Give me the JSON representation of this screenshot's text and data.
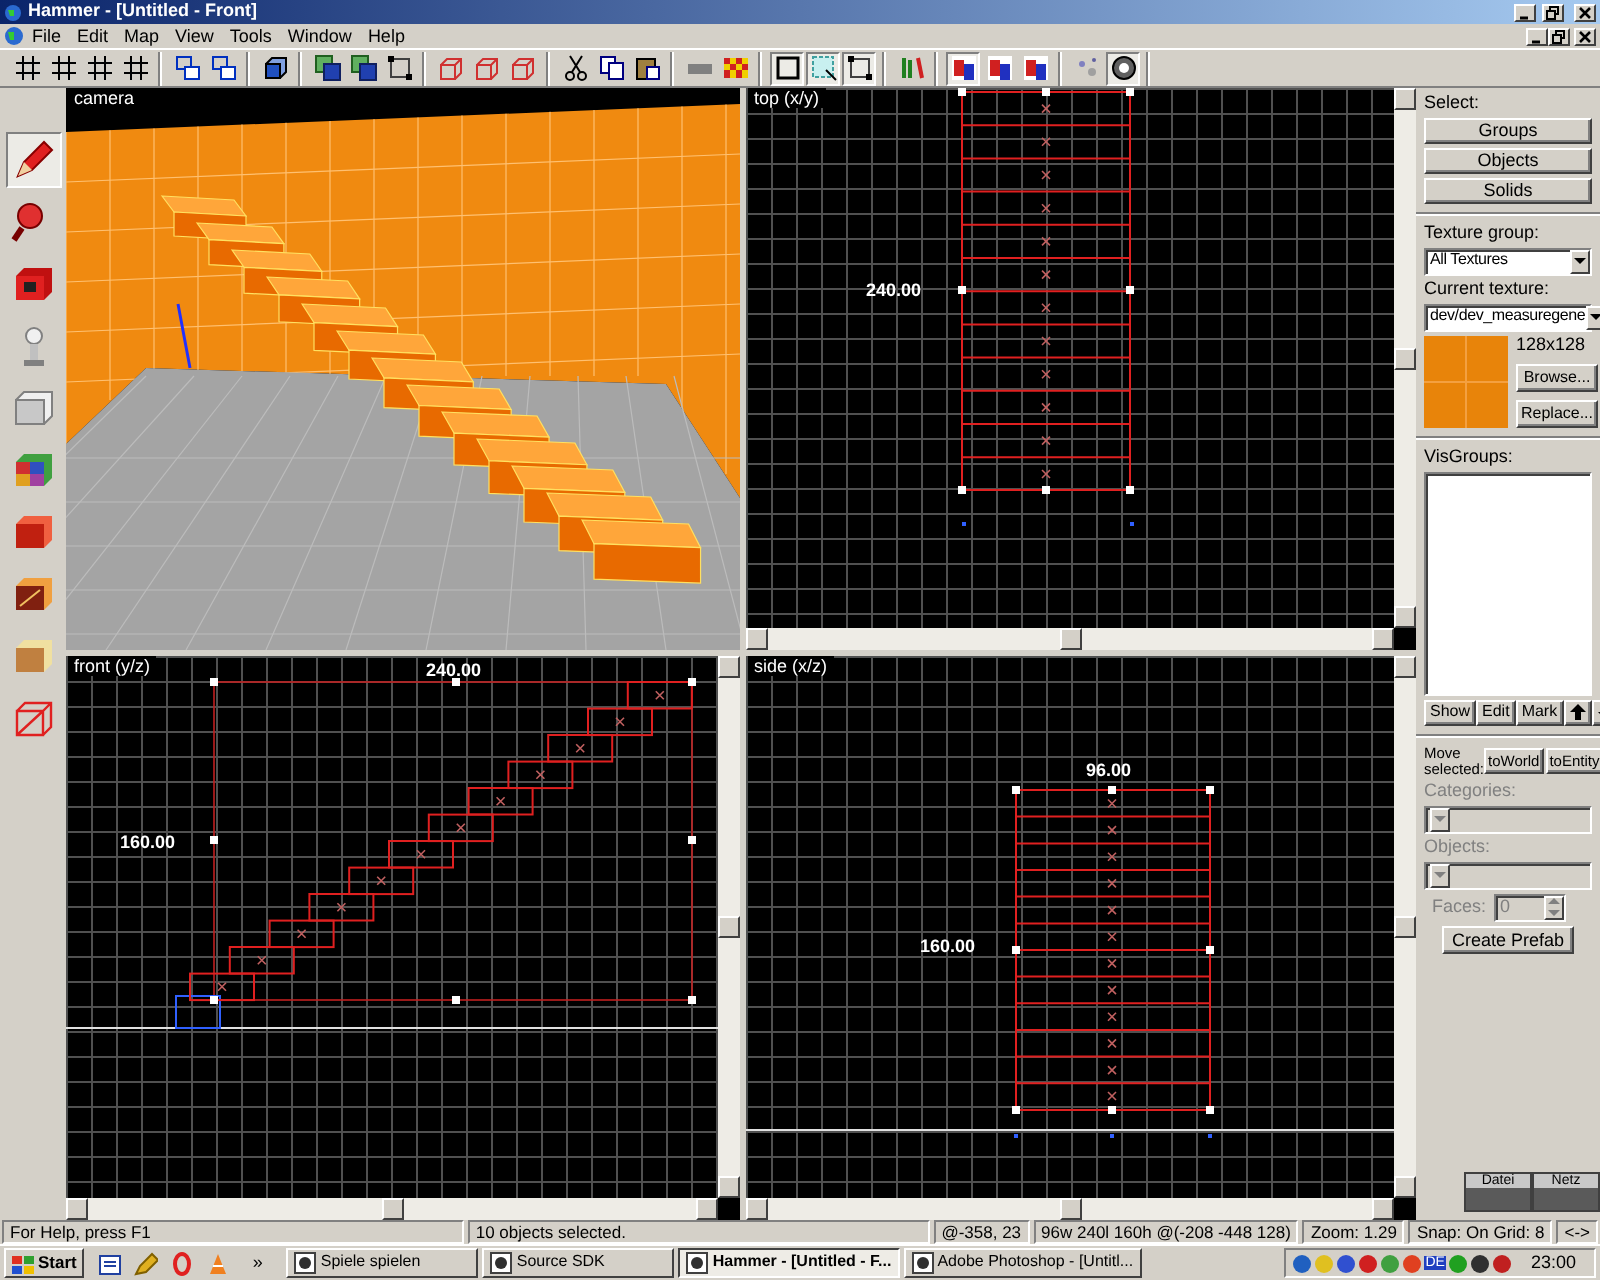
{
  "window": {
    "title": "Hammer - [Untitled - Front]"
  },
  "menu": [
    "File",
    "Edit",
    "Map",
    "View",
    "Tools",
    "Window",
    "Help"
  ],
  "toolbar": [
    [
      {
        "kind": "grid",
        "pressed": false
      },
      {
        "kind": "grid",
        "pressed": false
      },
      {
        "kind": "grid",
        "pressed": false
      },
      {
        "kind": "grid",
        "pressed": false
      }
    ],
    [
      {
        "kind": "layers",
        "pressed": false
      },
      {
        "kind": "layers",
        "pressed": false
      }
    ],
    [
      {
        "kind": "cube",
        "pressed": false
      }
    ],
    [
      {
        "kind": "group",
        "pressed": false
      },
      {
        "kind": "group",
        "pressed": false
      },
      {
        "kind": "handles",
        "pressed": false
      }
    ],
    [
      {
        "kind": "wirecube",
        "pressed": false
      },
      {
        "kind": "wirecube",
        "pressed": false
      },
      {
        "kind": "wirecube",
        "pressed": false
      }
    ],
    [
      {
        "kind": "scissors",
        "pressed": false
      },
      {
        "kind": "copy",
        "pressed": false
      },
      {
        "kind": "paste",
        "pressed": false
      }
    ],
    [
      {
        "kind": "bar",
        "pressed": false
      },
      {
        "kind": "checker",
        "pressed": false
      }
    ],
    [
      {
        "kind": "square",
        "pressed": true
      },
      {
        "kind": "dashed",
        "pressed": true
      },
      {
        "kind": "handles",
        "pressed": true
      }
    ],
    [
      {
        "kind": "sticks",
        "pressed": false
      }
    ],
    [
      {
        "kind": "tile",
        "pressed": true
      },
      {
        "kind": "tile",
        "pressed": false
      },
      {
        "kind": "tile",
        "pressed": false
      }
    ],
    [
      {
        "kind": "sparkle",
        "pressed": false
      },
      {
        "kind": "sphere",
        "pressed": true
      }
    ]
  ],
  "tools": [
    {
      "kind": "pencil",
      "selected": true
    },
    {
      "kind": "magnifier",
      "selected": false
    },
    {
      "kind": "camera",
      "selected": false
    },
    {
      "kind": "lamp",
      "selected": false
    },
    {
      "kind": "block",
      "selected": false
    },
    {
      "kind": "texture",
      "selected": false
    },
    {
      "kind": "redcube",
      "selected": false
    },
    {
      "kind": "darkcube",
      "selected": false
    },
    {
      "kind": "browncube",
      "selected": false
    },
    {
      "kind": "wire",
      "selected": false
    }
  ],
  "viewports": [
    {
      "kind": "camera",
      "label": "camera"
    },
    {
      "kind": "top",
      "label": "top (x/y)",
      "height_label": "240.00"
    },
    {
      "kind": "front",
      "label": "front (y/z)",
      "width_label": "240.00",
      "height_label": "160.00"
    },
    {
      "kind": "side",
      "label": "side (x/z)",
      "width_label": "96.00",
      "height_label": "160.00"
    }
  ],
  "side_panel": {
    "select_label": "Select:",
    "select_buttons": [
      "Groups",
      "Objects",
      "Solids"
    ],
    "texture_group": {
      "label": "Texture group:",
      "value": "All Textures"
    },
    "current_texture": {
      "label": "Current texture:",
      "value": "dev/dev_measuregene",
      "size": "128x128"
    },
    "texture_buttons": [
      "Browse...",
      "Replace..."
    ],
    "visgroups": {
      "label": "VisGroups:",
      "buttons": [
        "Show",
        "Edit",
        "Mark"
      ]
    },
    "move": {
      "label": "Move selected:",
      "buttons": [
        "toWorld",
        "toEntity"
      ]
    },
    "categories": {
      "label": "Categories:",
      "disabled": true
    },
    "objects": {
      "label": "Objects:",
      "disabled": true
    },
    "faces": {
      "label": "Faces:",
      "value": "0",
      "disabled": true
    },
    "create_prefab": "Create Prefab"
  },
  "corner_widget": [
    "Datei",
    "Netz"
  ],
  "status_bar": [
    "For Help, press F1",
    "10 objects selected.",
    "@-358, 23",
    "96w 240l 160h @(-208 -448 128)",
    "Zoom: 1.29",
    "Snap: On Grid: 8",
    "<->"
  ],
  "taskbar": {
    "start": "Start",
    "more": "»",
    "tasks": [
      {
        "label": "Spiele spielen",
        "selected": false
      },
      {
        "label": "Source SDK",
        "selected": false
      },
      {
        "label": "Hammer - [Untitled - F...",
        "selected": true
      },
      {
        "label": "Adobe Photoshop - [Untitl...",
        "selected": false
      }
    ],
    "tray": {
      "language": "DE",
      "clock": "23:00"
    }
  }
}
